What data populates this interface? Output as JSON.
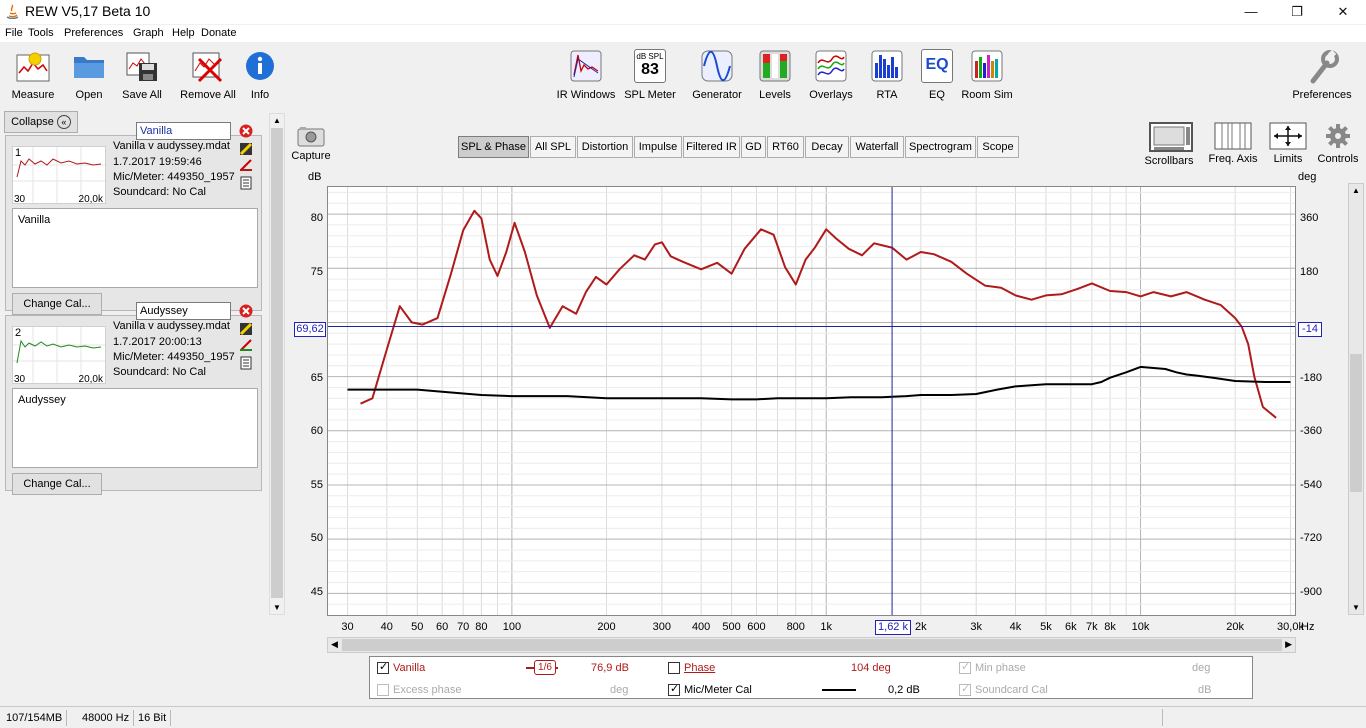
{
  "window": {
    "title": "REW V5,17 Beta 10",
    "minimize": "—",
    "restore": "❐",
    "close": "✕"
  },
  "menu": [
    "File",
    "Tools",
    "Preferences",
    "Graph",
    "Help",
    "Donate"
  ],
  "toolbar": {
    "left": [
      {
        "label": "Measure",
        "icon": "measure-icon"
      },
      {
        "label": "Open",
        "icon": "folder-icon"
      },
      {
        "label": "Save All",
        "icon": "save-all-icon"
      },
      {
        "label": "Remove All",
        "icon": "remove-all-icon"
      },
      {
        "label": "Info",
        "icon": "info-icon"
      }
    ],
    "center": [
      {
        "label": "IR Windows",
        "icon": "ir-windows-icon"
      },
      {
        "label": "SPL Meter",
        "icon": "spl-meter-icon",
        "badge_top": "dB SPL",
        "badge_value": "83"
      },
      {
        "label": "Generator",
        "icon": "generator-icon"
      },
      {
        "label": "Levels",
        "icon": "levels-icon"
      },
      {
        "label": "Overlays",
        "icon": "overlays-icon"
      },
      {
        "label": "RTA",
        "icon": "rta-icon"
      },
      {
        "label": "EQ",
        "icon": "eq-icon",
        "badge": "EQ"
      },
      {
        "label": "Room Sim",
        "icon": "room-sim-icon"
      }
    ],
    "right": {
      "label": "Preferences",
      "icon": "wrench-icon"
    }
  },
  "left_panel": {
    "collapse_label": "Collapse",
    "measurements": [
      {
        "index": "1",
        "name": "Vanilla",
        "file": "Vanilla v audyssey.mdat",
        "date": "1.7.2017 19:59:46",
        "mic": "Mic/Meter: 449350_1957",
        "soundcard": "Soundcard: No Cal",
        "notes": "Vanilla",
        "thumb_x_min": "30",
        "thumb_x_max": "20,0k",
        "color": "#b01a1a",
        "change_cal": "Change Cal..."
      },
      {
        "index": "2",
        "name": "Audyssey",
        "file": "Vanilla v audyssey.mdat",
        "date": "1.7.2017 20:00:13",
        "mic": "Mic/Meter: 449350_1957",
        "soundcard": "Soundcard: No Cal",
        "notes": "Audyssey",
        "thumb_x_min": "30",
        "thumb_x_max": "20,0k",
        "color": "#1f8a1f",
        "change_cal": "Change Cal..."
      }
    ]
  },
  "graph_toolbar": {
    "capture": "Capture",
    "tabs": [
      "SPL & Phase",
      "All SPL",
      "Distortion",
      "Impulse",
      "Filtered IR",
      "GD",
      "RT60",
      "Decay",
      "Waterfall",
      "Spectrogram",
      "Scope"
    ],
    "selected_tab": "SPL & Phase",
    "right_buttons": [
      "Scrollbars",
      "Freq. Axis",
      "Limits",
      "Controls"
    ]
  },
  "graph": {
    "left_unit": "dB",
    "right_unit": "deg",
    "x_unit": "Hz",
    "cursor_freq_label": "1,62 k",
    "cursor_left_value": "69,62",
    "cursor_right_value": "-14",
    "y_ticks": [
      "80",
      "75",
      "70",
      "65",
      "60",
      "55",
      "50",
      "45"
    ],
    "y_ticks_right": [
      "360",
      "180",
      "0",
      "-180",
      "-360",
      "-540",
      "-720",
      "-900"
    ],
    "x_ticks": [
      "30",
      "40",
      "50",
      "60",
      "70",
      "80",
      "100",
      "200",
      "300",
      "400",
      "500",
      "600",
      "800",
      "1k",
      "2k",
      "3k",
      "4k",
      "5k",
      "6k",
      "7k",
      "8k",
      "10k",
      "20k",
      "30,0k"
    ]
  },
  "chart_data": {
    "type": "line",
    "xlabel": "Hz",
    "ylabel": "dB",
    "ylabel_right": "deg",
    "x_scale": "log",
    "xlim": [
      26,
      31000
    ],
    "ylim": [
      43,
      82.5
    ],
    "ylim_right": [
      -990,
      432
    ],
    "grid": true,
    "cursor": {
      "x": 1620,
      "y": 69.62,
      "y_right": -14
    },
    "series": [
      {
        "name": "Vanilla",
        "color": "#b01a1a",
        "x": [
          33,
          36,
          40,
          44,
          48,
          52,
          58,
          64,
          70,
          76,
          80,
          85,
          90,
          96,
          102,
          110,
          120,
          132,
          145,
          160,
          172,
          185,
          200,
          220,
          245,
          265,
          285,
          300,
          320,
          350,
          400,
          450,
          500,
          550,
          620,
          680,
          740,
          800,
          860,
          920,
          1000,
          1080,
          1180,
          1300,
          1420,
          1620,
          1800,
          2000,
          2200,
          2500,
          2800,
          3200,
          3600,
          4000,
          4500,
          5000,
          5600,
          6300,
          7000,
          8000,
          9000,
          10000,
          11000,
          12500,
          14000,
          16000,
          18000,
          20000,
          21000,
          22000,
          23000,
          24500,
          27000
        ],
        "values": [
          62.5,
          63,
          67.5,
          71.5,
          70,
          69.8,
          70.4,
          74.5,
          78.5,
          80.3,
          79.6,
          75.8,
          74.3,
          76.5,
          79.2,
          76.5,
          72.5,
          69.5,
          71.5,
          70.8,
          72.8,
          74.2,
          73.5,
          74.9,
          76.2,
          75.8,
          77.2,
          77.4,
          76.1,
          75.6,
          74.9,
          75.5,
          74.5,
          76.8,
          78.6,
          78.1,
          75.1,
          73.5,
          75.8,
          76.9,
          78.6,
          77.7,
          76.8,
          76.2,
          77.3,
          76.9,
          75.8,
          76.5,
          76.3,
          75.6,
          74.5,
          73.4,
          73.2,
          72.5,
          72.1,
          72.5,
          72.6,
          73.1,
          73.6,
          72.9,
          72.8,
          72.4,
          72.8,
          72.4,
          72.8,
          72.1,
          71.6,
          70.4,
          69.6,
          68,
          65,
          62.2,
          61.2
        ]
      },
      {
        "name": "Mic/Meter Cal",
        "color": "#000000",
        "x": [
          30,
          40,
          50,
          60,
          80,
          100,
          150,
          200,
          300,
          400,
          500,
          600,
          700,
          800,
          1000,
          1200,
          1500,
          1800,
          2000,
          2500,
          3000,
          3500,
          4000,
          4500,
          5000,
          6000,
          7000,
          7500,
          8000,
          9000,
          10000,
          11000,
          12000,
          13000,
          14000,
          15000,
          17000,
          20000,
          25000,
          30000
        ],
        "values": [
          63.8,
          63.8,
          63.8,
          63.6,
          63.3,
          63.2,
          63.2,
          63,
          63,
          63,
          62.9,
          62.9,
          63,
          63,
          63,
          63.1,
          63.1,
          63.2,
          63.3,
          63.3,
          63.4,
          63.8,
          64.1,
          64.2,
          64.3,
          64.3,
          64.3,
          64.5,
          64.9,
          65.4,
          65.9,
          65.8,
          65.7,
          65.4,
          65.2,
          65.1,
          64.9,
          64.6,
          64.5,
          64.5
        ]
      }
    ]
  },
  "legend": {
    "row1": [
      {
        "label": "Vanilla",
        "checked": true,
        "enabled": true,
        "color": "#b01a1a",
        "smoothing": "1/6",
        "value": "76,9 dB"
      },
      {
        "label": "Phase",
        "checked": false,
        "enabled": true,
        "color": "#b01a1a",
        "value": "104 deg"
      },
      {
        "label": "Min phase",
        "checked": true,
        "enabled": false,
        "value": "deg"
      }
    ],
    "row2": [
      {
        "label": "Excess phase",
        "checked": false,
        "enabled": false,
        "value": "deg"
      },
      {
        "label": "Mic/Meter Cal",
        "checked": true,
        "enabled": true,
        "color": "#000000",
        "value": "0,2 dB"
      },
      {
        "label": "Soundcard Cal",
        "checked": true,
        "enabled": false,
        "value": "dB"
      }
    ]
  },
  "status": {
    "memory": "107/154MB",
    "rate": "48000 Hz",
    "bits": "16 Bit"
  }
}
